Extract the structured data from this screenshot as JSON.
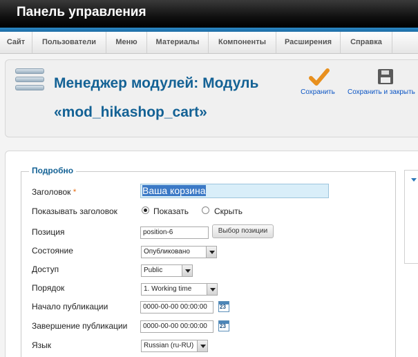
{
  "header": {
    "title": "Панель управления"
  },
  "menu": [
    {
      "label": "Сайт"
    },
    {
      "label": "Пользователи"
    },
    {
      "label": "Меню"
    },
    {
      "label": "Материалы"
    },
    {
      "label": "Компоненты"
    },
    {
      "label": "Расширения"
    },
    {
      "label": "Справка"
    }
  ],
  "toolbar": {
    "page_title": "Менеджер модулей: Модуль «mod_hikashop_cart»",
    "save_label": "Сохранить",
    "save_close_label": "Сохранить и закрыть"
  },
  "form": {
    "legend": "Подробно",
    "title_label": "Заголовок",
    "required_mark": "*",
    "title_value": "Ваша корзина",
    "show_title_label": "Показывать заголовок",
    "show_option": "Показать",
    "hide_option": "Скрыть",
    "show_title_selected": "Показать",
    "position_label": "Позиция",
    "position_value": "position-6",
    "position_button": "Выбор позиции",
    "status_label": "Состояние",
    "status_value": "Опубликовано",
    "access_label": "Доступ",
    "access_value": "Public",
    "ordering_label": "Порядок",
    "ordering_value": "1. Working time",
    "publish_up_label": "Начало публикации",
    "publish_up_value": "0000-00-00 00:00:00",
    "publish_down_label": "Завершение публикации",
    "publish_down_value": "0000-00-00 00:00:00",
    "calendar_day": "23",
    "language_label": "Язык",
    "language_value": "Russian (ru-RU)"
  },
  "colors": {
    "accent_blue": "#146295",
    "link_blue": "#0b55c4",
    "header_bar": "#1a6aa3",
    "required": "#e8731b",
    "save_check": "#e8901e"
  }
}
